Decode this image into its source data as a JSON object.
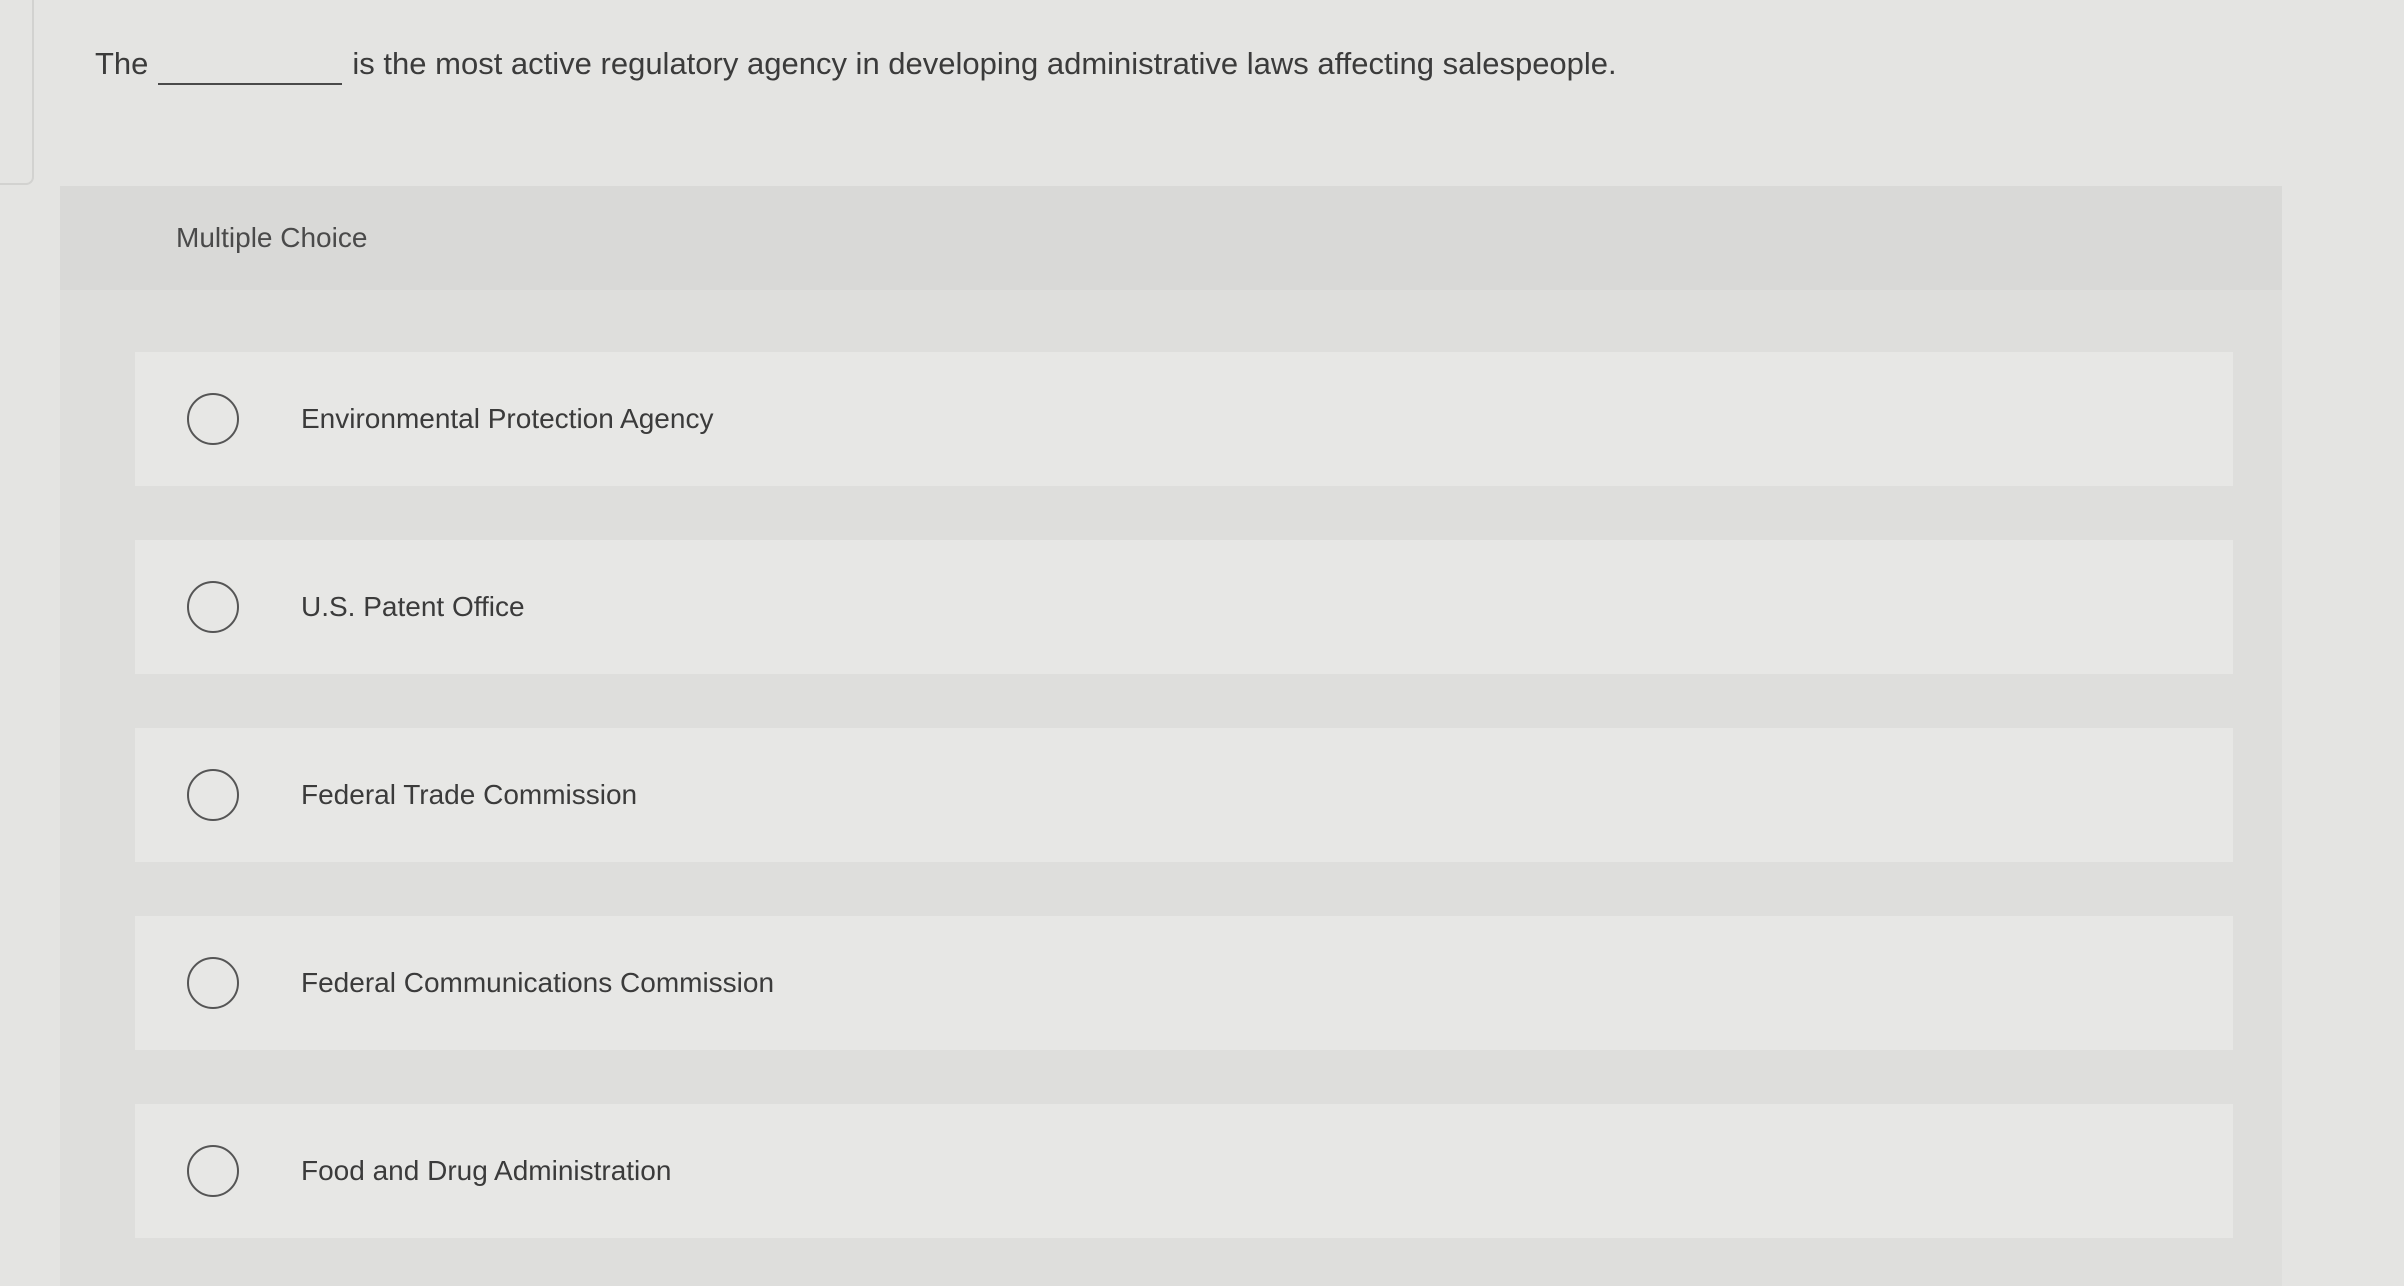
{
  "question": {
    "prefix": "The",
    "suffix": "is the most active regulatory agency in developing administrative laws affecting salespeople."
  },
  "multiple_choice": {
    "header": "Multiple Choice",
    "options": [
      "Environmental Protection Agency",
      "U.S. Patent Office",
      "Federal Trade Commission",
      "Federal Communications Commission",
      "Food and Drug Administration"
    ],
    "selected": null
  }
}
